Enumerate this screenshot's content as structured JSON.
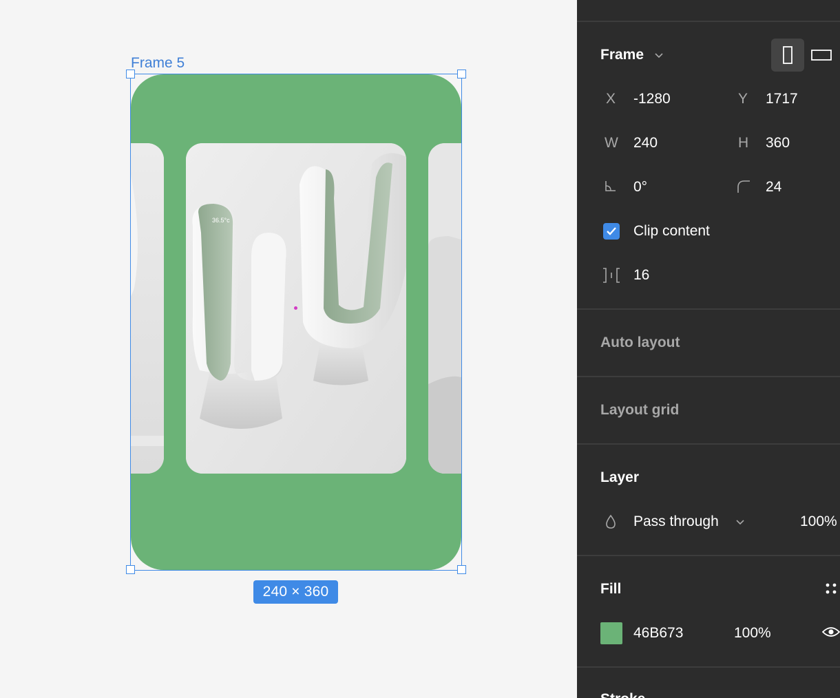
{
  "canvas": {
    "frame_name": "Frame 5",
    "frame_fill": "#6BB377",
    "size_label": "240 × 360",
    "product_display": "36.5°c"
  },
  "panel": {
    "frame_section": {
      "title": "Frame"
    },
    "position": {
      "x_label": "X",
      "x_value": "-1280",
      "y_label": "Y",
      "y_value": "1717"
    },
    "size": {
      "w_label": "W",
      "w_value": "240",
      "h_label": "H",
      "h_value": "360"
    },
    "rotation_value": "0°",
    "corner_radius_value": "24",
    "clip_content": {
      "label": "Clip content",
      "checked": true
    },
    "spacing_value": "16",
    "auto_layout": {
      "title": "Auto layout"
    },
    "layout_grid": {
      "title": "Layout grid"
    },
    "layer": {
      "title": "Layer",
      "blend_mode": "Pass through",
      "opacity": "100%"
    },
    "fill": {
      "title": "Fill",
      "hex": "46B673",
      "opacity": "100%",
      "swatch_color": "#6BB377"
    },
    "stroke": {
      "title": "Stroke"
    }
  },
  "icons": {
    "chevron": "chevron-down-icon",
    "portrait": "portrait-icon",
    "landscape": "landscape-icon",
    "rotation": "rotation-icon",
    "radius": "corner-radius-icon",
    "spacing": "spacing-icon",
    "blend": "drop-icon",
    "styles": "style-grid-icon",
    "visibility": "eye-icon",
    "check": "checkmark-icon"
  },
  "colors": {
    "selection": "#3F8AE6",
    "panel_bg": "#2C2C2C",
    "canvas_bg": "#F5F5F5"
  }
}
